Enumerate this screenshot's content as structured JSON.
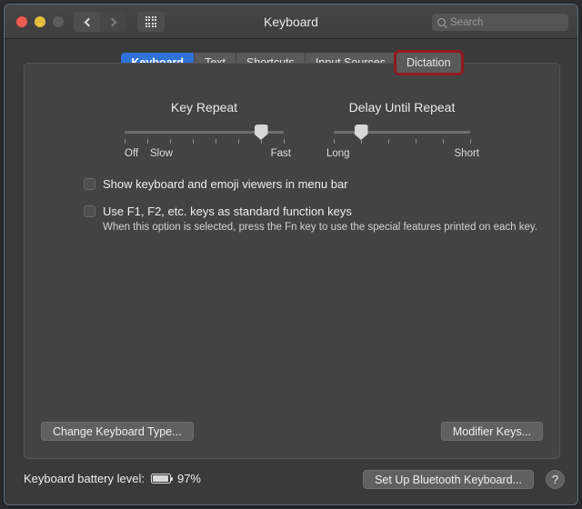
{
  "window": {
    "title": "Keyboard",
    "traffic_lights": [
      "close",
      "minimize",
      "zoom"
    ],
    "nav": {
      "back": "‹",
      "forward": "›"
    },
    "search": {
      "placeholder": "Search",
      "value": ""
    }
  },
  "tabs": [
    {
      "label": "Keyboard",
      "state": "active"
    },
    {
      "label": "Text",
      "state": "normal"
    },
    {
      "label": "Shortcuts",
      "state": "normal"
    },
    {
      "label": "Input Sources",
      "state": "normal"
    },
    {
      "label": "Dictation",
      "state": "highlighted"
    }
  ],
  "sliders": {
    "key_repeat": {
      "title": "Key Repeat",
      "ticks": 8,
      "value_index": 7,
      "labels": {
        "left": "Off",
        "left2": "Slow",
        "right": "Fast"
      }
    },
    "delay_until_repeat": {
      "title": "Delay Until Repeat",
      "ticks": 6,
      "value_index": 2,
      "labels": {
        "left": "Long",
        "right": "Short"
      }
    }
  },
  "checkboxes": [
    {
      "label": "Show keyboard and emoji viewers in menu bar",
      "checked": false
    },
    {
      "label": "Use F1, F2, etc. keys as standard function keys",
      "checked": false
    }
  ],
  "help_text": "When this option is selected, press the Fn key to use the special features printed on each key.",
  "buttons": {
    "change_keyboard_type": "Change Keyboard Type...",
    "modifier_keys": "Modifier Keys...",
    "setup_bluetooth_keyboard": "Set Up Bluetooth Keyboard...",
    "help": "?"
  },
  "footer": {
    "battery_label": "Keyboard battery level:",
    "battery_percent": "97%",
    "battery_fill_ratio": 0.97
  },
  "colors": {
    "accent_blue": "#2f72d8",
    "highlight_red": "#8f1b21",
    "window_bg": "#3a3a3a",
    "panel_bg": "#434343",
    "close": "#f05a50",
    "minimize": "#e6c03c",
    "zoom": "#5c5c5c"
  }
}
